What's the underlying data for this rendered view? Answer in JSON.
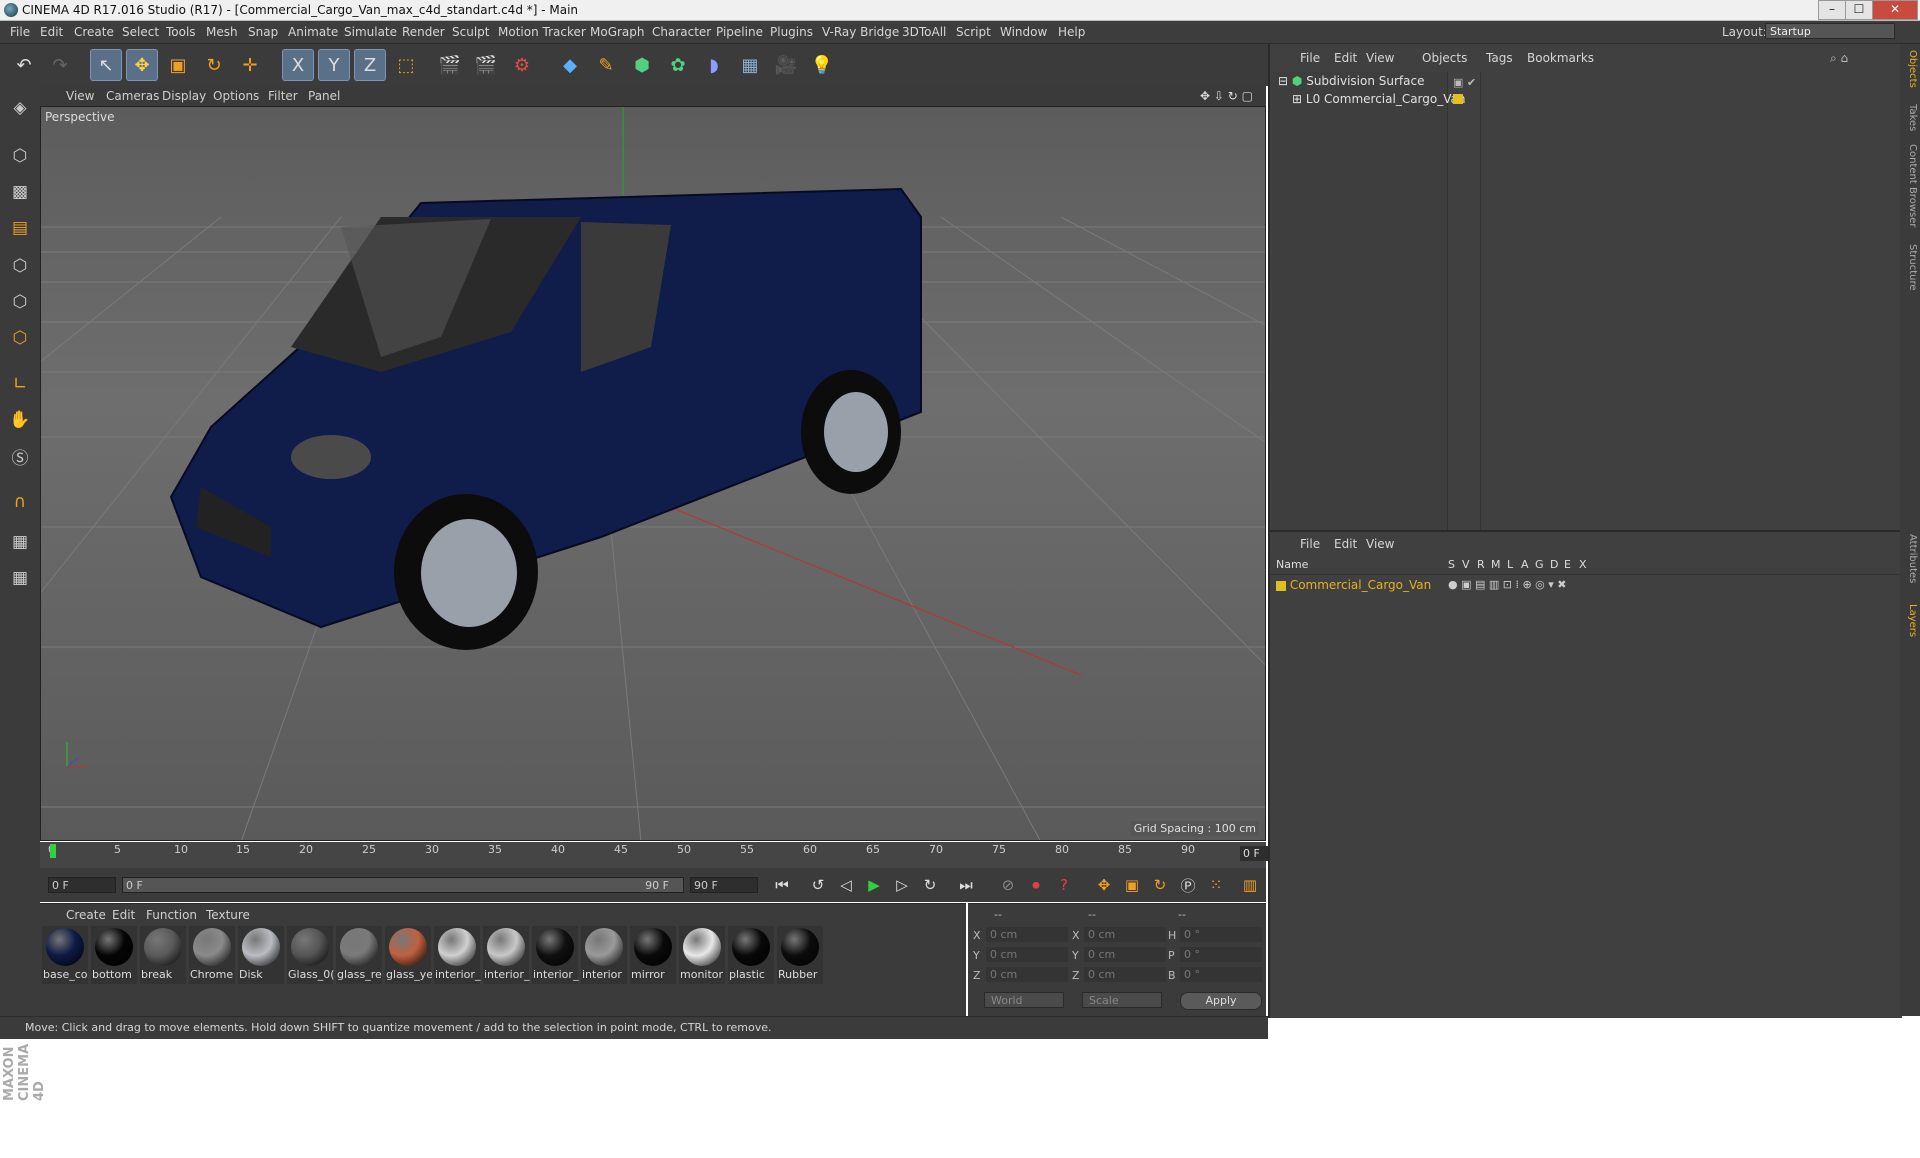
{
  "window": {
    "title": "CINEMA 4D R17.016 Studio (R17) - [Commercial_Cargo_Van_max_c4d_standart.c4d *] - Main",
    "buttons": [
      "–",
      "☐",
      "✕"
    ]
  },
  "menu": {
    "items": [
      "File",
      "Edit",
      "Create",
      "Select",
      "Tools",
      "Mesh",
      "Snap",
      "Animate",
      "Simulate",
      "Render",
      "Sculpt",
      "Motion Tracker",
      "MoGraph",
      "Character",
      "Pipeline",
      "Plugins",
      "V-Ray Bridge",
      "3DToAll",
      "Script",
      "Window",
      "Help"
    ],
    "layout_label": "Layout:",
    "layout_value": "Startup"
  },
  "toolbar": {
    "axis_x": "X",
    "axis_y": "Y",
    "axis_z": "Z"
  },
  "viewport": {
    "menu": [
      "View",
      "Cameras",
      "Display",
      "Options",
      "Filter",
      "Panel"
    ],
    "label": "Perspective",
    "grid_spacing": "Grid Spacing : 100 cm"
  },
  "timeline": {
    "ticks": [
      "0",
      "5",
      "10",
      "15",
      "20",
      "25",
      "30",
      "35",
      "40",
      "45",
      "50",
      "55",
      "60",
      "65",
      "70",
      "75",
      "80",
      "85",
      "90"
    ],
    "end_field": "0 F",
    "start_field": "0 F",
    "range_start": "0 F",
    "range_end": "90 F",
    "max_field": "90 F"
  },
  "materials": {
    "menu": [
      "Create",
      "Edit",
      "Function",
      "Texture"
    ],
    "items": [
      {
        "name": "base_co",
        "color": "#0d1a45"
      },
      {
        "name": "bottom",
        "color": "#050505"
      },
      {
        "name": "break",
        "color": "#5a5a5a"
      },
      {
        "name": "Chrome",
        "color": "#8a8a8a"
      },
      {
        "name": "Disk",
        "color": "#b9bcc2"
      },
      {
        "name": "Glass_0(",
        "color": "#555555"
      },
      {
        "name": "glass_re",
        "color": "#7a7a7a"
      },
      {
        "name": "glass_ye",
        "color": "#c06040"
      },
      {
        "name": "interior_",
        "color": "#d0d0d0"
      },
      {
        "name": "interior_",
        "color": "#c8c8c8"
      },
      {
        "name": "interior_",
        "color": "#101010"
      },
      {
        "name": "interior",
        "color": "#9a9a9a"
      },
      {
        "name": "mirror",
        "color": "#0a0a0a"
      },
      {
        "name": "monitor",
        "color": "#e8e8e8"
      },
      {
        "name": "plastic",
        "color": "#080808"
      },
      {
        "name": "Rubber",
        "color": "#0c0c0c"
      }
    ]
  },
  "coordinates": {
    "headers": [
      "--",
      "--",
      "--"
    ],
    "rows": [
      {
        "a": "X",
        "av": "0 cm",
        "b": "X",
        "bv": "0 cm",
        "c": "H",
        "cv": "0 °"
      },
      {
        "a": "Y",
        "av": "0 cm",
        "b": "Y",
        "bv": "0 cm",
        "c": "P",
        "cv": "0 °"
      },
      {
        "a": "Z",
        "av": "0 cm",
        "b": "Z",
        "bv": "0 cm",
        "c": "B",
        "cv": "0 °"
      }
    ],
    "mode": "World",
    "scale": "Scale",
    "apply": "Apply"
  },
  "status": {
    "text": "Move: Click and drag to move elements. Hold down SHIFT to quantize movement / add to the selection in point mode, CTRL to remove."
  },
  "objects": {
    "menu": [
      "File",
      "Edit",
      "View",
      "Objects",
      "Tags",
      "Bookmarks"
    ],
    "items": [
      {
        "name": "Subdivision Surface"
      },
      {
        "name": "Commercial_Cargo_Van"
      }
    ]
  },
  "layers": {
    "menu": [
      "File",
      "Edit",
      "View"
    ],
    "columns": [
      "Name",
      "S",
      "V",
      "R",
      "M",
      "L",
      "A",
      "G",
      "D",
      "E",
      "X"
    ],
    "items": [
      {
        "name": "Commercial_Cargo_Van",
        "color": "#e0c020"
      }
    ]
  },
  "side_tabs": [
    "Objects",
    "Takes",
    "Content Browser",
    "Structure",
    "Attributes",
    "Layers"
  ],
  "branding": "MAXON CINEMA 4D"
}
